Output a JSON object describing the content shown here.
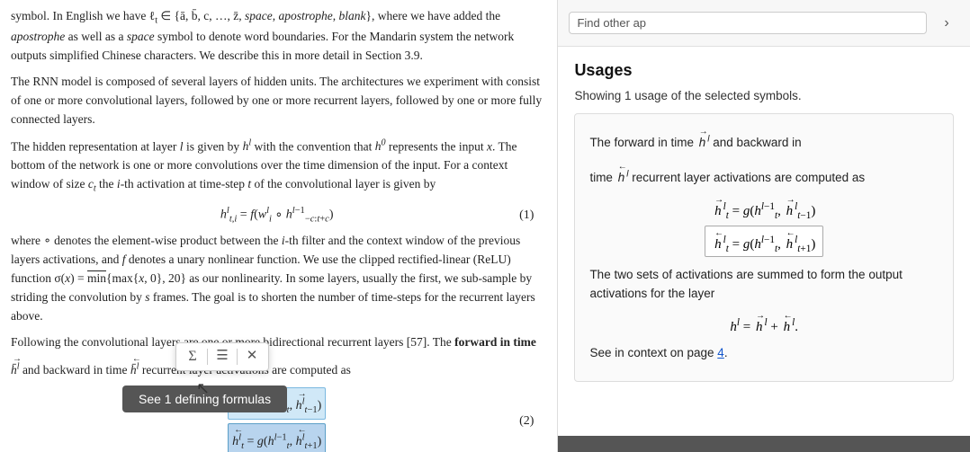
{
  "left": {
    "para1": "symbol. In English we have ℓ_t ∈ {ā, b̄, c, ..., z̄, space, apostrophe, blank}, where we have added the apostrophe as well as a space symbol to denote word boundaries. For the Mandarin system the network outputs simplified Chinese characters. We describe this in more detail in Section 3.9.",
    "para2": "The RNN model is composed of several layers of hidden units. The architectures we experiment with consist of one or more convolutional layers, followed by one or more recurrent layers, followed by one or more fully connected layers.",
    "para3": "The hidden representation at layer l is given by h^l with the convention that h^0 represents the input x. The bottom of the network is one or more convolutions over the time dimension of the input. For a context window of size c_t the i-th activation at time-step t of the convolutional layer is given by",
    "para4": "where ○ denotes the element-wise product between the i-th filter and the context window of the previous layers activations, and f denotes a unary nonlinear function. We use the clipped rectified-linear (ReLU) function σ(x) = min{max{x, 0}, 20} as our nonlinearity. In some layers, usually the first, we sub-sample by striding the convolution by s frames. The goal is to shorten the number of time-steps for the recurrent layers above.",
    "para5_prefix": "Following the convolutional layers are one or more bidirectional recurrent layers [57]. The ",
    "para5_bold": "forward in time",
    "para5_mid": " h̄^l and backward in time h̄^l recurrent layer activations are computed as",
    "eq1_label": "(1)",
    "eq2_label": "(2)",
    "toolbar": {
      "hamburger": "☰",
      "close": "✕"
    },
    "button_label": "See 1 defining formulas"
  },
  "right": {
    "search_placeholder": "Find other ap",
    "section_title": "Usages",
    "showing_text": "Showing 1 usage of the selected symbols.",
    "usage": {
      "text1": "The forward in time",
      "text2": "and backward in",
      "text3": "time",
      "text4": "recurrent layer activations are",
      "text5": "computed as",
      "text6": "The two sets of activations are summed to form the output activations for the layer",
      "context_prefix": "See in context on page ",
      "context_page": "4",
      "context_suffix": "."
    }
  }
}
